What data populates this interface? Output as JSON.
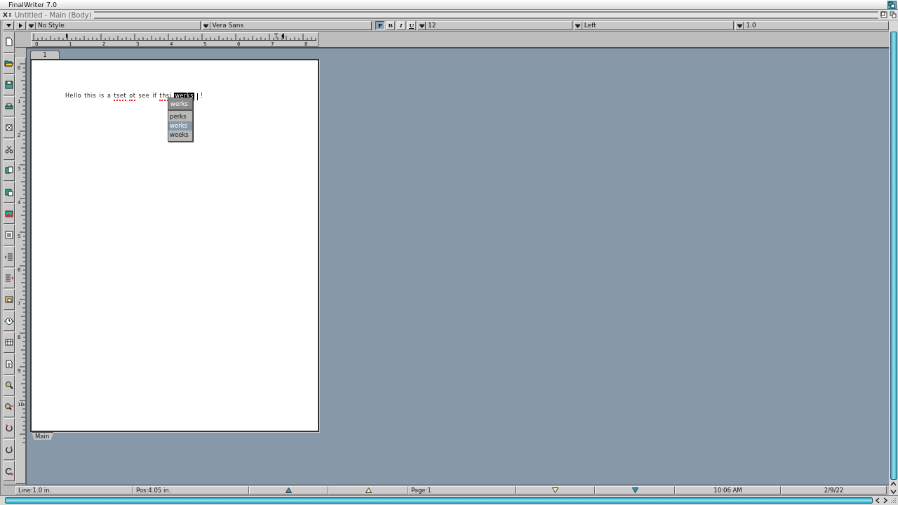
{
  "screen": {
    "title": "FinalWriter 7.0"
  },
  "window": {
    "title": "Untitled - Main (Body)"
  },
  "toolbar": {
    "style": "No Style",
    "font": "Vera Sans",
    "format_buttons": [
      {
        "label": "P",
        "selected": true
      },
      {
        "label": "B",
        "selected": false
      },
      {
        "label": "I",
        "selected": false
      },
      {
        "label": "U",
        "selected": false
      }
    ],
    "size": "12",
    "alignment": "Left",
    "spacing": "1.0"
  },
  "ruler": {
    "labels": [
      "0",
      "1",
      "2",
      "3",
      "4",
      "5",
      "6",
      "7",
      "8"
    ]
  },
  "vertical_ruler": {
    "labels": [
      "0",
      "1",
      "2",
      "3",
      "4",
      "5",
      "6",
      "7",
      "8",
      "9",
      "10"
    ]
  },
  "page_tab": "1",
  "section_tab": "Main",
  "document": {
    "words": [
      {
        "text": "Hello",
        "misspelled": false,
        "selected": false
      },
      {
        "text": "this",
        "misspelled": false,
        "selected": false
      },
      {
        "text": "is",
        "misspelled": false,
        "selected": false
      },
      {
        "text": "a",
        "misspelled": false,
        "selected": false
      },
      {
        "text": "tset",
        "misspelled": true,
        "selected": false
      },
      {
        "text": "ot",
        "misspelled": true,
        "selected": false
      },
      {
        "text": "see",
        "misspelled": false,
        "selected": false
      },
      {
        "text": "if",
        "misspelled": false,
        "selected": false
      },
      {
        "text": "thsi",
        "misspelled": true,
        "selected": false
      },
      {
        "text": "werks",
        "misspelled": true,
        "selected": true
      },
      {
        "text": "!",
        "misspelled": false,
        "selected": false
      }
    ]
  },
  "spell_menu": {
    "word": "werks",
    "suggestions": [
      {
        "label": "perks",
        "selected": false
      },
      {
        "label": "works",
        "selected": true
      },
      {
        "label": "weeks",
        "selected": false
      }
    ]
  },
  "status_bar": {
    "line": "Line:1.0 in.",
    "pos": "Pos:4.05 in.",
    "page": "Page:1",
    "time": "10:06 AM",
    "date": "2/9/22"
  }
}
